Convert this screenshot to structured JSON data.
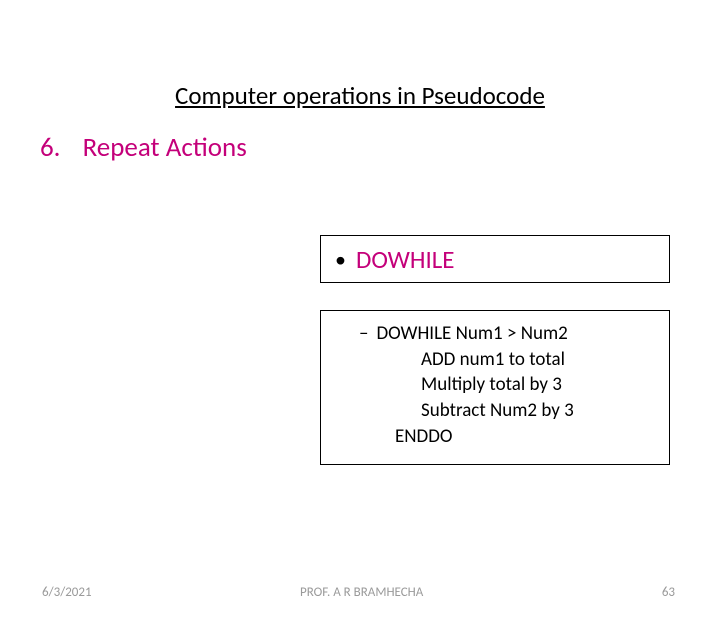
{
  "title": "Computer operations in Pseudocode",
  "section": {
    "number": "6.",
    "name": "Repeat Actions"
  },
  "keyword": "DOWHILE",
  "code": {
    "head": "DOWHILE Num1 > Num2",
    "lines": [
      "ADD num1 to total",
      "Multiply total by 3",
      "Subtract Num2 by 3"
    ],
    "end": "ENDDO"
  },
  "footer": {
    "date": "6/3/2021",
    "author": "PROF. A R BRAMHECHA",
    "page": "63"
  }
}
